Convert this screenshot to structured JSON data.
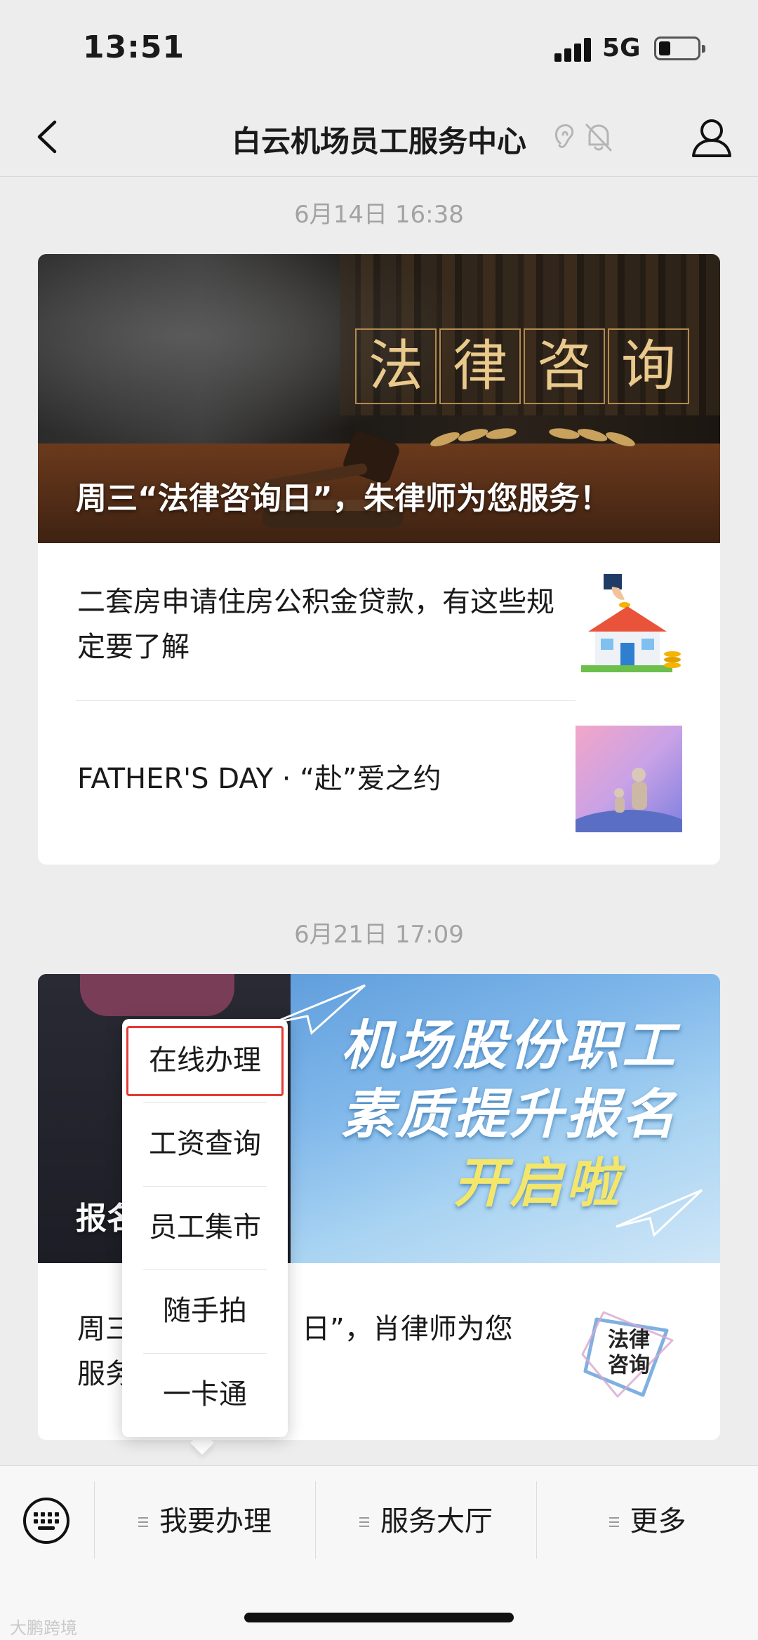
{
  "status_bar": {
    "time": "13:51",
    "network": "5G",
    "battery_level": 0.3
  },
  "nav": {
    "title": "白云机场员工服务中心"
  },
  "messages": [
    {
      "timestamp": "6月14日 16:38",
      "cover_title": "周三“法律咨询日”，朱律师为您服务！",
      "cover_characters": [
        "法",
        "律",
        "咨",
        "询"
      ],
      "articles": [
        {
          "title": "二套房申请住房公积金贷款，有这些规定要了解",
          "thumb_icon": "house-coins-thumbnail"
        },
        {
          "title": "FATHER'S DAY · “赴”爱之约",
          "thumb_icon": "father-child-thumbnail"
        }
      ]
    },
    {
      "timestamp": "6月21日 17:09",
      "cover_lines": [
        "机场股份职工",
        "素质提升报名",
        "开启啦"
      ],
      "cover_title_partial": "报名",
      "articles": [
        {
          "title_part1": "周三",
          "title_part2": "日”，肖律师为您",
          "title_part3": "服务",
          "thumb_text": "法律咨询",
          "thumb_icon": "legal-consultancy-logo"
        }
      ]
    }
  ],
  "popup_menu": {
    "items": [
      "在线办理",
      "工资查询",
      "员工集市",
      "随手拍",
      "一卡通"
    ],
    "highlighted_index": 0
  },
  "bottom_menu": {
    "items": [
      "我要办理",
      "服务大厅",
      "更多"
    ]
  },
  "watermark": "大鹏跨境"
}
